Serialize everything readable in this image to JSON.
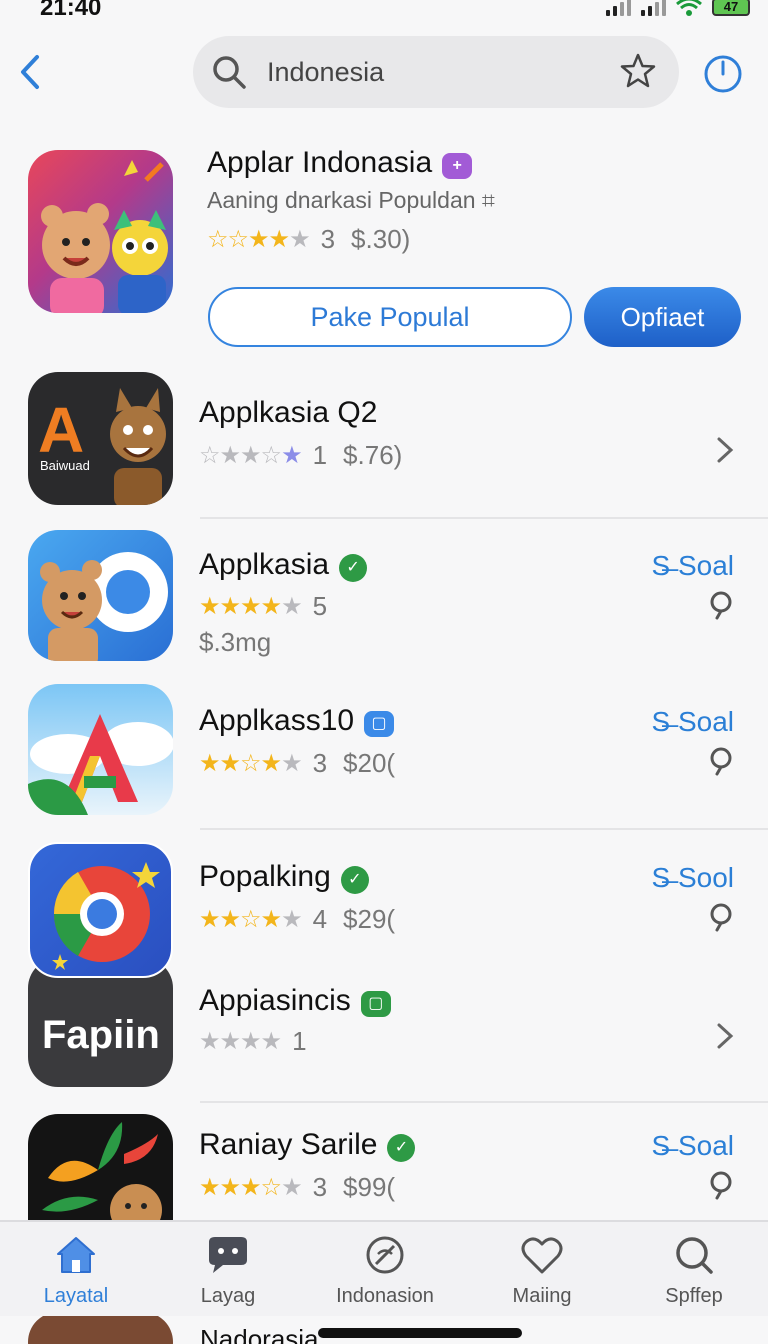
{
  "status": {
    "time": "21:40",
    "battery": "47"
  },
  "search": {
    "value": "Indonesia"
  },
  "featured": {
    "name": "Applar Indonasia",
    "subtitle": "Aaning dnarkasi Populdan ⌗",
    "rating": "3",
    "price": "$.30)",
    "stars_filled": 2.5,
    "outline_button": "Pake Populal",
    "primary_button": "Opfiaet",
    "badge_color": "#a25bd6"
  },
  "apps": [
    {
      "name": "Applkasia Q2",
      "rating": "1",
      "price": "$.76)"
    },
    {
      "name": "Applkasia",
      "rating": "5",
      "price": "$.3mg",
      "link": "S̶ Soal"
    },
    {
      "name": "Applkass10",
      "rating": "3",
      "price": "$20(",
      "link": "S̶ Soal"
    },
    {
      "name": "Popalking",
      "rating": "4",
      "price": "$29(",
      "link": "S̶ Sool"
    },
    {
      "name": "Appiasincis",
      "rating": "1"
    },
    {
      "name": "Raniay Sarile",
      "rating": "3",
      "price": "$99(",
      "link": "S̶ Soal"
    }
  ],
  "icons": {
    "app4_text": "Fapiin",
    "app1_text": "A",
    "app1_caption": "Baiwuad"
  },
  "tabs": [
    {
      "label": "Layatal",
      "icon": "home-icon"
    },
    {
      "label": "Layag",
      "icon": "chat-icon"
    },
    {
      "label": "Indonasion",
      "icon": "compass-icon"
    },
    {
      "label": "Maiing",
      "icon": "heart-icon"
    },
    {
      "label": "Spffep",
      "icon": "search-icon"
    }
  ],
  "peek": {
    "name": "Nadorasia"
  },
  "colors": {
    "accent": "#2f7fd8",
    "star": "#f3b51b",
    "green_badge": "#2e9a45",
    "blue_badge": "#3b8ae8"
  }
}
